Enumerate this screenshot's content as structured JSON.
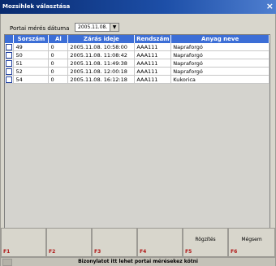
{
  "window": {
    "title": "Mozsihlek választása",
    "close": "×"
  },
  "date": {
    "label": "Portai mérés dátuma",
    "value": "2005.11.08."
  },
  "table": {
    "headers": [
      "Sorszám",
      "Al",
      "Zárás ideje",
      "Rendszám",
      "Anyag neve"
    ],
    "rows": [
      [
        "49",
        "0",
        "2005.11.08. 10:58:00",
        "AAA111",
        "Napraforgó"
      ],
      [
        "50",
        "0",
        "2005.11.08. 11:08:42",
        "AAA111",
        "Napraforgó"
      ],
      [
        "51",
        "0",
        "2005.11.08. 11:49:38",
        "AAA111",
        "Napraforgó"
      ],
      [
        "52",
        "0",
        "2005.11.08. 12:00:18",
        "AAA111",
        "Napraforgó"
      ],
      [
        "54",
        "0",
        "2005.11.08. 16:12:18",
        "AAA111",
        "Kukorica"
      ]
    ]
  },
  "fkeys": [
    {
      "num": "F1",
      "label": ""
    },
    {
      "num": "F2",
      "label": ""
    },
    {
      "num": "F3",
      "label": ""
    },
    {
      "num": "F4",
      "label": ""
    },
    {
      "num": "F5",
      "label": "Rögzítés"
    },
    {
      "num": "F6",
      "label": "Mégsem"
    }
  ],
  "status": {
    "message": "Bizonylatot itt lehet portai mérésekez kötni"
  }
}
